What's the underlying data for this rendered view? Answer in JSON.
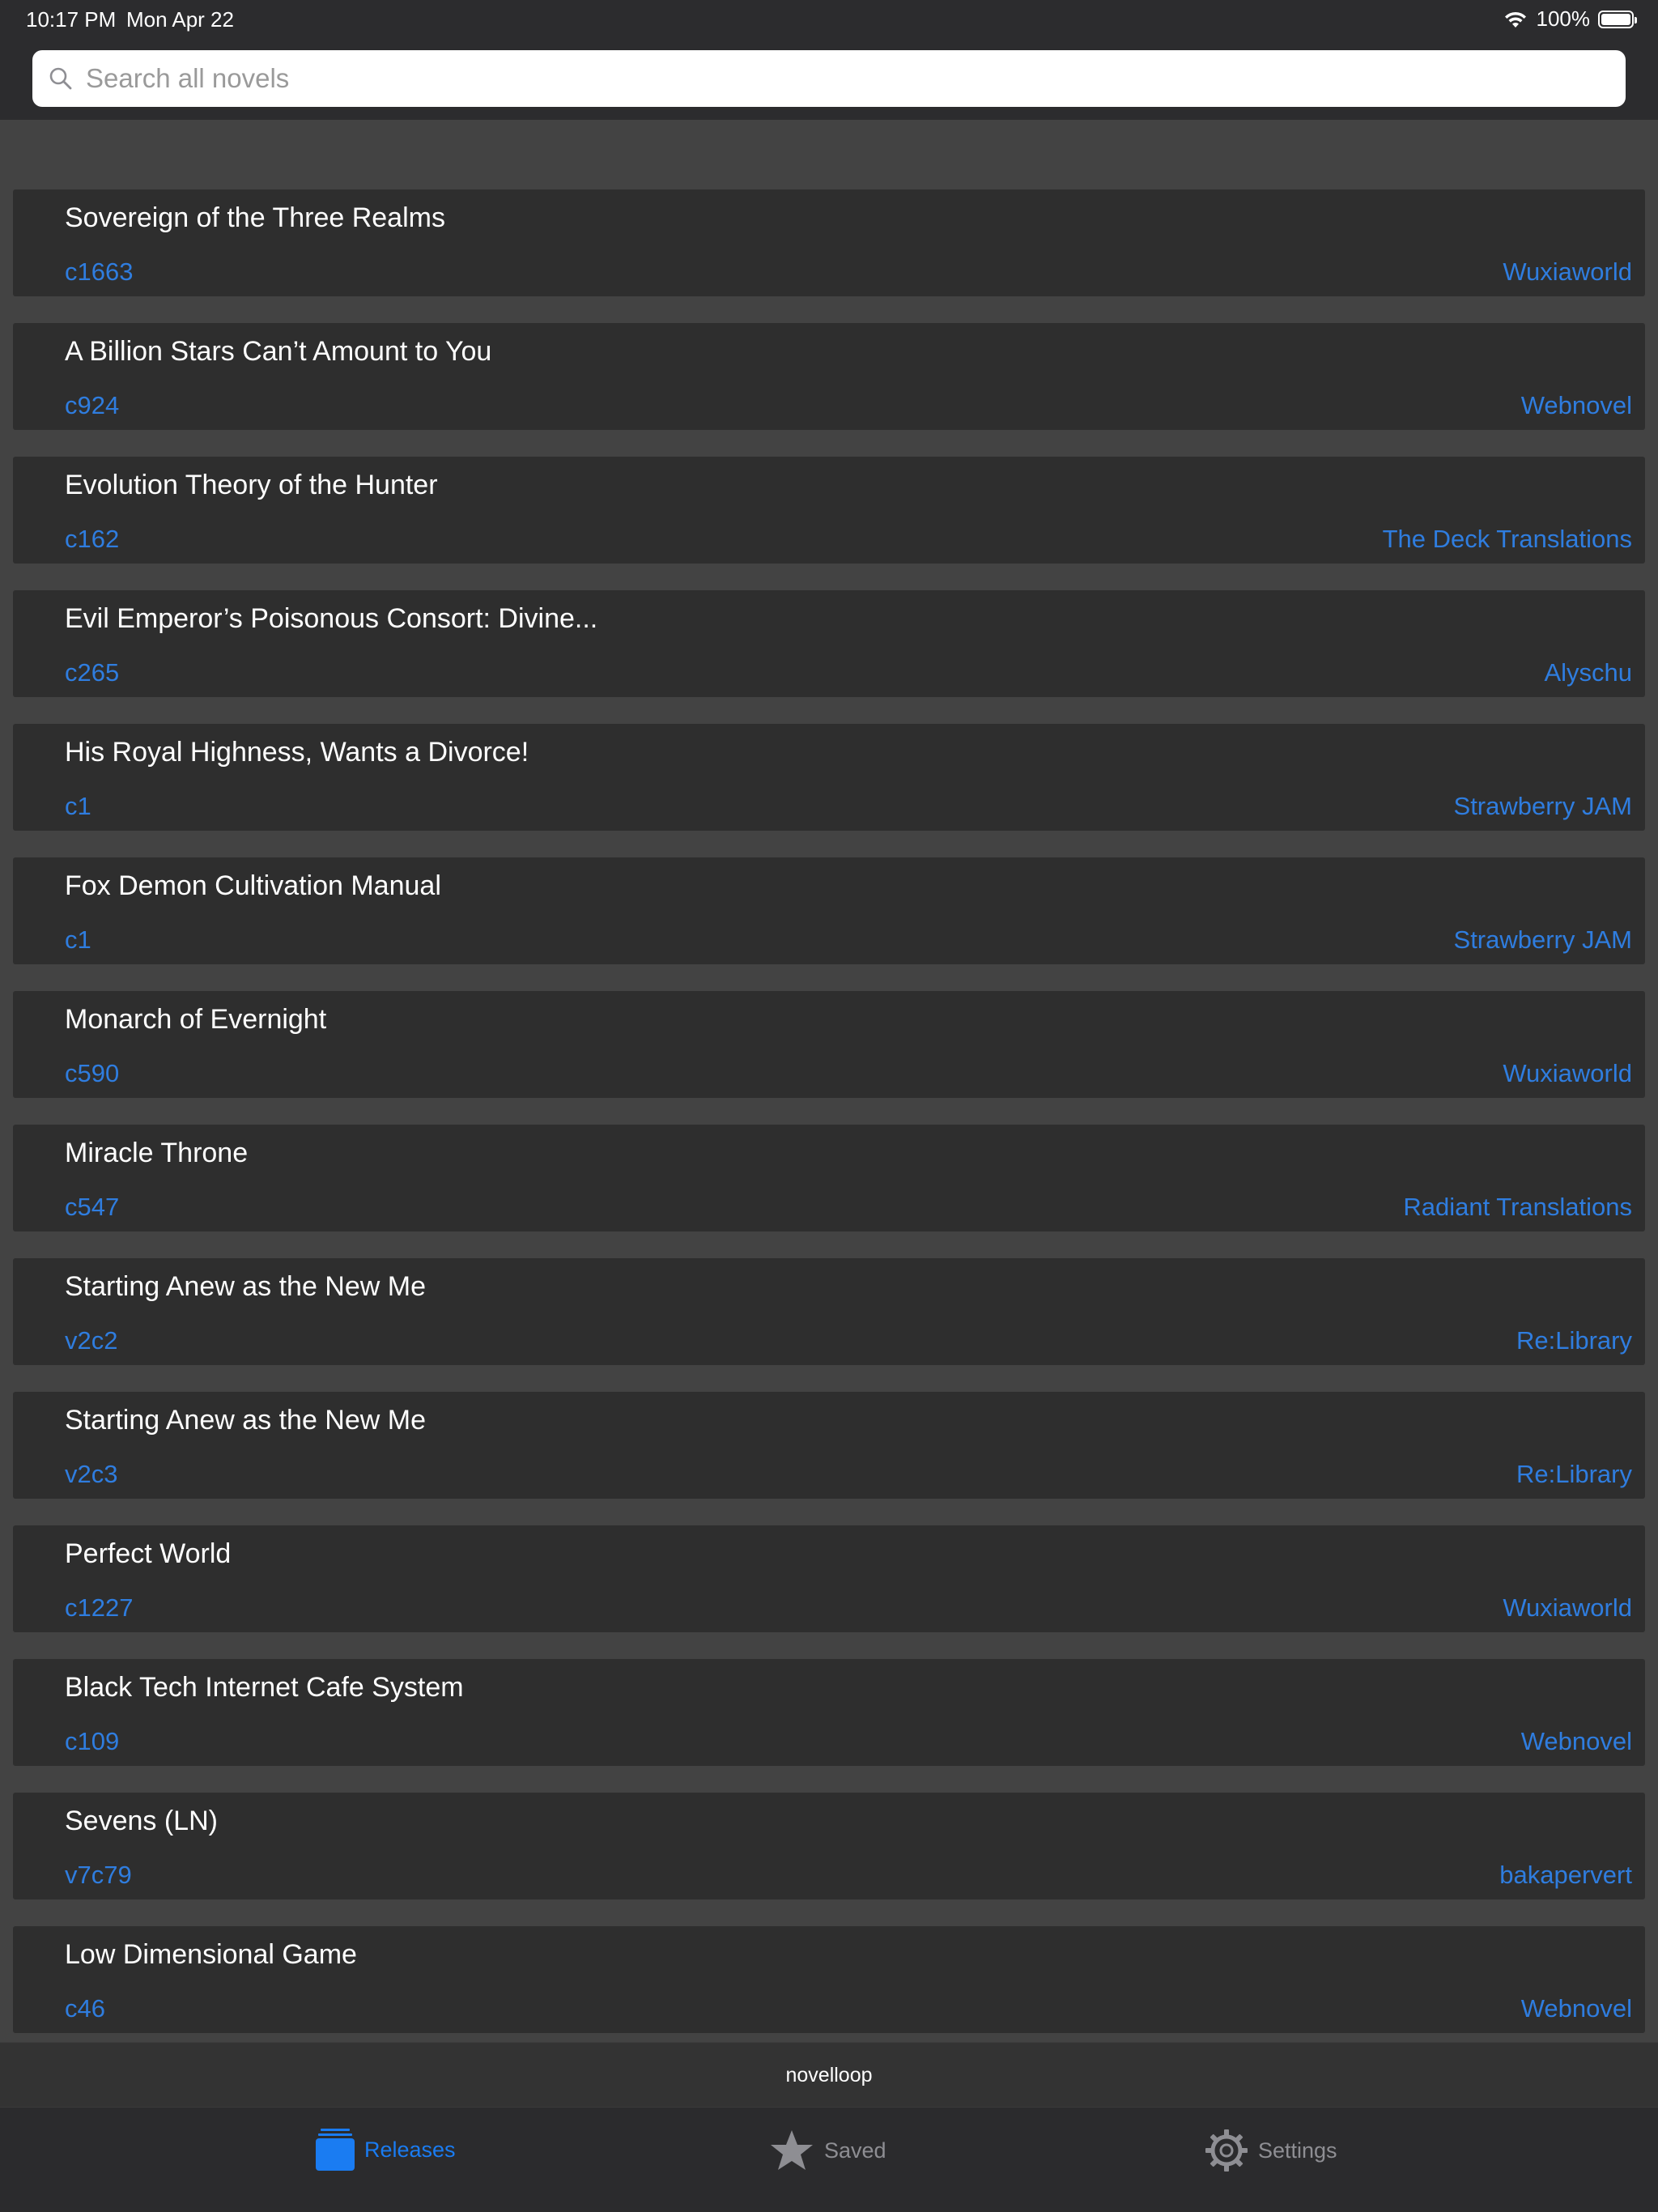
{
  "status_bar": {
    "time": "10:17 PM",
    "date": "Mon Apr 22",
    "battery": "100%",
    "battery_level": 1.0
  },
  "search": {
    "placeholder": "Search all novels"
  },
  "releases": [
    {
      "title": "Sovereign of the Three Realms",
      "chapter": "c1663",
      "group": "Wuxiaworld"
    },
    {
      "title": "A Billion Stars Can’t Amount to You",
      "chapter": "c924",
      "group": "Webnovel"
    },
    {
      "title": "Evolution Theory of the Hunter",
      "chapter": "c162",
      "group": "The Deck Translations"
    },
    {
      "title": "Evil Emperor’s Poisonous Consort: Divine...",
      "chapter": "c265",
      "group": "Alyschu"
    },
    {
      "title": "His Royal Highness, Wants a Divorce!",
      "chapter": "c1",
      "group": "Strawberry JAM"
    },
    {
      "title": "Fox Demon Cultivation Manual",
      "chapter": "c1",
      "group": "Strawberry JAM"
    },
    {
      "title": "Monarch of Evernight",
      "chapter": "c590",
      "group": "Wuxiaworld"
    },
    {
      "title": "Miracle Throne",
      "chapter": "c547",
      "group": "Radiant Translations"
    },
    {
      "title": "Starting Anew as the New Me",
      "chapter": "v2c2",
      "group": "Re:Library"
    },
    {
      "title": "Starting Anew as the New Me",
      "chapter": "v2c3",
      "group": "Re:Library"
    },
    {
      "title": "Perfect World",
      "chapter": "c1227",
      "group": "Wuxiaworld"
    },
    {
      "title": "Black Tech Internet Cafe System",
      "chapter": "c109",
      "group": "Webnovel"
    },
    {
      "title": "Sevens (LN)",
      "chapter": "v7c79",
      "group": "bakapervert"
    },
    {
      "title": "Low Dimensional Game",
      "chapter": "c46",
      "group": "Webnovel"
    }
  ],
  "footer": {
    "app_name": "novelloop"
  },
  "tabs": [
    {
      "label": "Releases",
      "icon": "releases-icon",
      "active": true
    },
    {
      "label": "Saved",
      "icon": "star-icon",
      "active": false
    },
    {
      "label": "Settings",
      "icon": "gear-icon",
      "active": false
    }
  ],
  "colors": {
    "accent": "#1a7cf2",
    "link": "#2f7ddf",
    "background": "#434343",
    "cell": "#2e2e2e",
    "inactive_tab": "#8e8e93"
  }
}
